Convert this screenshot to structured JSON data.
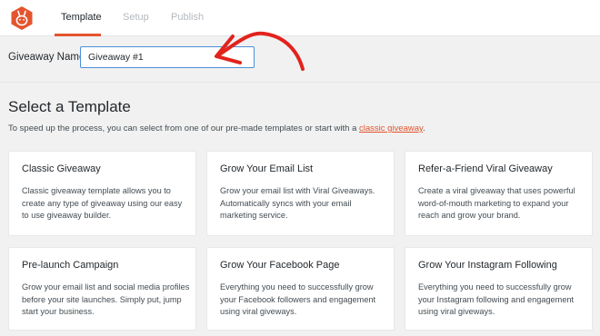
{
  "header": {
    "logo": "rafflepress-bunny-logo",
    "tabs": [
      {
        "label": "Template",
        "active": true
      },
      {
        "label": "Setup",
        "active": false
      },
      {
        "label": "Publish",
        "active": false
      }
    ],
    "accent_color": "#e4542e"
  },
  "giveaway_name": {
    "label": "Giveaway Name",
    "value": "Giveaway #1",
    "annotation": "red-hand-drawn-arrow-icon"
  },
  "templates": {
    "title": "Select a Template",
    "intro_text": "To speed up the process, you can select from one of our pre-made templates or start with a",
    "intro_link": "classic giveaway",
    "intro_end": ".",
    "cards": [
      {
        "title": "Classic Giveaway",
        "description": "Classic giveaway template allows you to create any type of giveaway using our easy to use giveaway builder."
      },
      {
        "title": "Grow Your Email List",
        "description": "Grow your email list with Viral Giveaways. Automatically syncs with your email marketing service."
      },
      {
        "title": "Refer-a-Friend Viral Giveaway",
        "description": "Create a viral giveaway that uses powerful word-of-mouth marketing to expand your reach and grow your brand."
      },
      {
        "title": "Pre-launch Campaign",
        "description": "Grow your email list and social media profiles before your site launches. Simply put, jump start your business."
      },
      {
        "title": "Grow Your Facebook Page",
        "description": "Everything you need to successfully grow your Facebook followers and engagement using viral giveways."
      },
      {
        "title": "Grow Your Instagram Following",
        "description": "Everything you need to successfully grow your Instagram following and engagement using viral giveways."
      }
    ]
  }
}
